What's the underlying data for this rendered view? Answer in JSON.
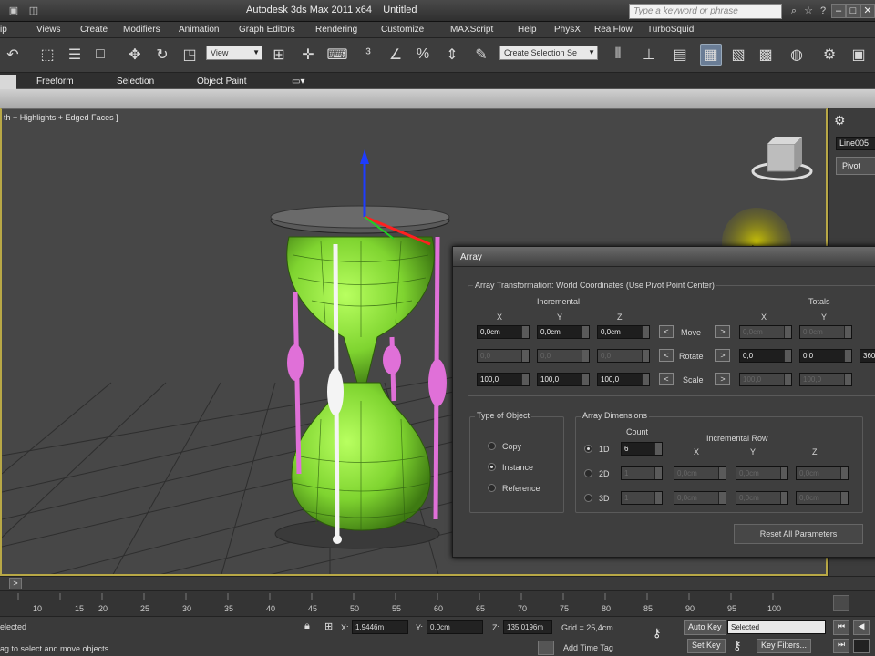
{
  "titlebar": {
    "app_title": "Autodesk 3ds Max  2011 x64",
    "doc_title": "Untitled",
    "search_placeholder": "Type a keyword or phrase"
  },
  "menu": [
    "ip",
    "Views",
    "Create",
    "Modifiers",
    "Animation",
    "Graph Editors",
    "Rendering",
    "Customize",
    "MAXScript",
    "Help",
    "PhysX",
    "RealFlow",
    "TurboSquid"
  ],
  "toolbar": {
    "refcoord_value": "View",
    "selection_set_placeholder": "Create Selection Se"
  },
  "ribbon": {
    "tabs": [
      "Freeform",
      "Selection",
      "Object Paint"
    ]
  },
  "viewport": {
    "label": "th + Highlights + Edged Faces ]"
  },
  "command_panel": {
    "object_name": "Line005",
    "pivot_label": "Pivot"
  },
  "array_dialog": {
    "title": "Array",
    "transformation_caption": "Array Transformation: World Coordinates (Use Pivot Point Center)",
    "incremental_label": "Incremental",
    "totals_label": "Totals",
    "axes": [
      "X",
      "Y",
      "Z"
    ],
    "move_label": "Move",
    "rotate_label": "Rotate",
    "scale_label": "Scale",
    "move_values": [
      "0,0cm",
      "0,0cm",
      "0,0cm"
    ],
    "rotate_values": [
      "0,0",
      "0,0",
      "0,0"
    ],
    "scale_values": [
      "100,0",
      "100,0",
      "100,0"
    ],
    "totals_move": [
      "0,0cm",
      "0,0cm"
    ],
    "totals_rotate": [
      "0,0",
      "0,0",
      "360"
    ],
    "totals_scale": [
      "100,0",
      "100,0"
    ],
    "type_of_object_caption": "Type of Object",
    "object_types": [
      "Copy",
      "Instance",
      "Reference"
    ],
    "selected_object_type": "Instance",
    "array_dimensions_caption": "Array Dimensions",
    "count_label": "Count",
    "incremental_row_label": "Incremental Row",
    "dimensions": [
      "1D",
      "2D",
      "3D"
    ],
    "selected_dimension": "1D",
    "count_value": "6",
    "dim_disabled_values": [
      "1",
      "0,0cm"
    ],
    "reset_button": "Reset All Parameters"
  },
  "timeline": {
    "ticks": [
      "10",
      "15",
      "20",
      "25",
      "30",
      "35",
      "40",
      "45",
      "50",
      "55",
      "60",
      "65",
      "70",
      "75",
      "80",
      "85",
      "90",
      "95",
      "100"
    ],
    "slider_arrow": ">"
  },
  "status": {
    "selection_text": "elected",
    "prompt_text": "ag to select and move objects",
    "x_label": "X:",
    "x_value": "1,9446m",
    "y_label": "Y:",
    "y_value": "0,0cm",
    "z_label": "Z:",
    "z_value": "135,0196m",
    "grid_text": "Grid = 25,4cm",
    "add_time_tag": "Add Time Tag",
    "auto_key": "Auto Key",
    "set_key": "Set Key",
    "selected_dropdown": "Selected",
    "key_filters": "Key Filters..."
  },
  "colors": {
    "viewport_bg": "#474747",
    "active_border": "#b8a846",
    "hourglass_glass": "#8ce43a",
    "selected_wire": "#e070d8",
    "dialog_bg": "#3e3e3e",
    "cursor_highlight": "#c8c000"
  }
}
